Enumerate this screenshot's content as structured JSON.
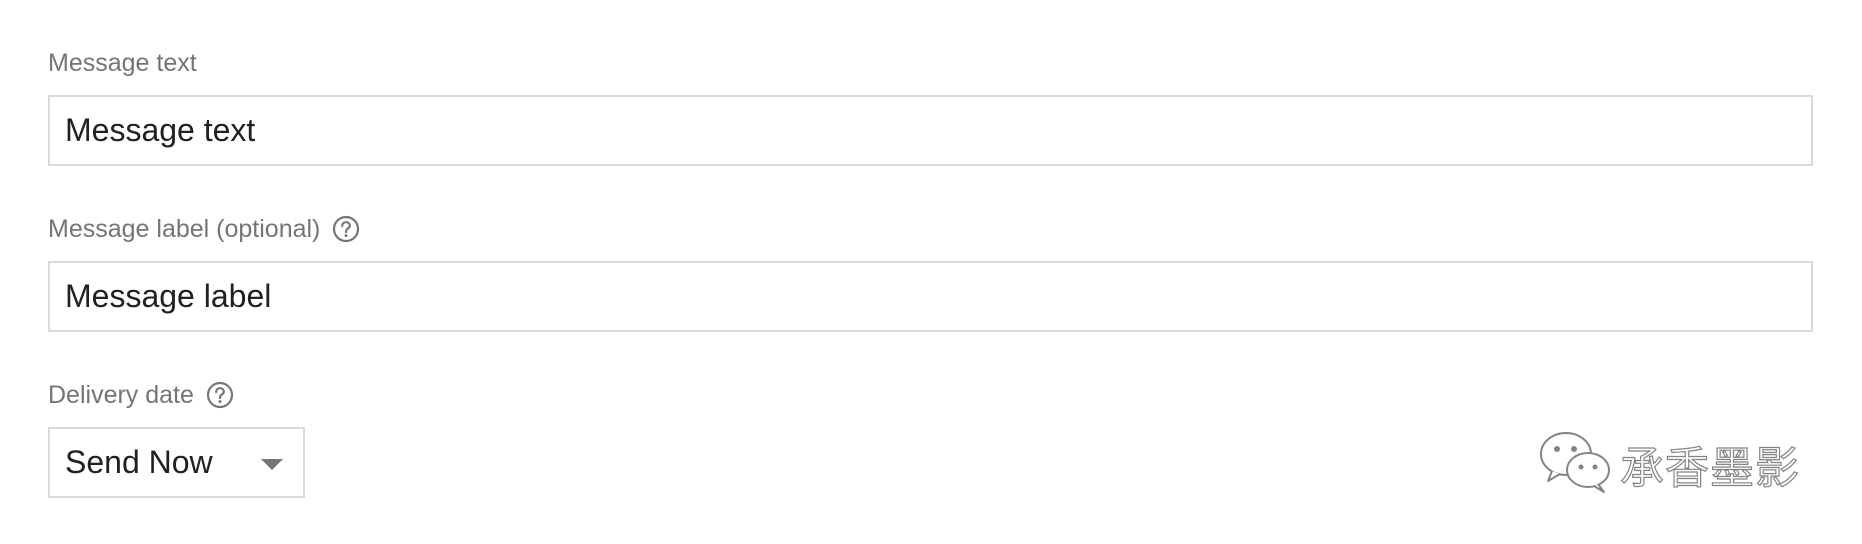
{
  "form": {
    "message_text": {
      "label": "Message text",
      "placeholder": "Message text"
    },
    "message_label": {
      "label": "Message label (optional)",
      "placeholder": "Message label",
      "help_icon": "help-circle-icon"
    },
    "delivery_date": {
      "label": "Delivery date",
      "selected": "Send Now",
      "help_icon": "help-circle-icon",
      "caret_icon": "caret-down-icon"
    }
  },
  "watermark": {
    "icon": "wechat-icon",
    "text": "承香墨影"
  },
  "colors": {
    "label": "#757575",
    "input_border": "#dadada",
    "input_text": "#212121"
  }
}
